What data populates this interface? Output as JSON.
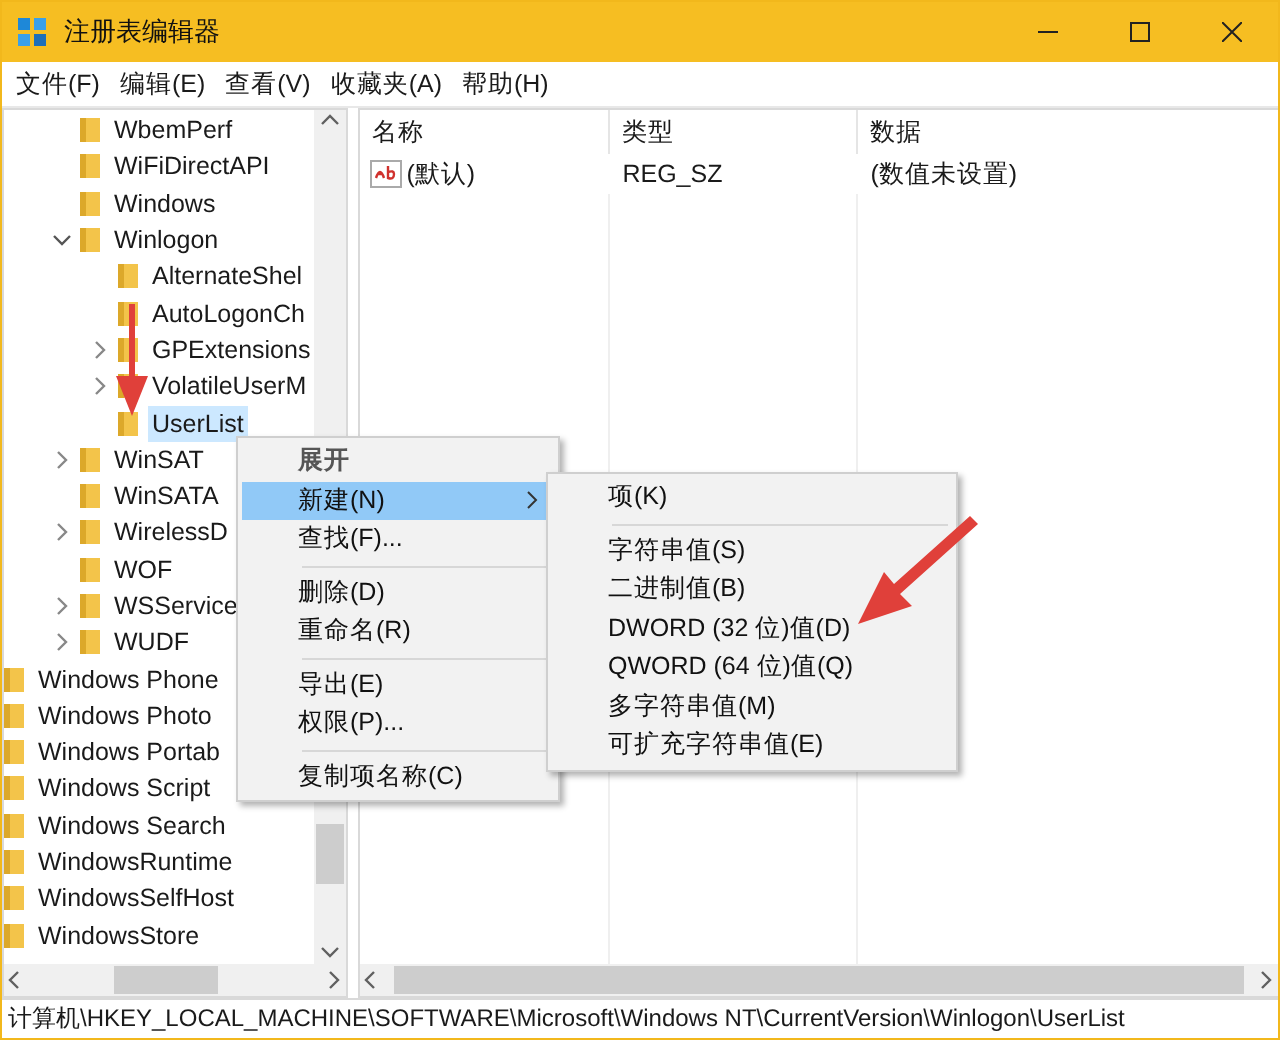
{
  "window": {
    "title": "注册表编辑器"
  },
  "menu_bar": [
    {
      "label": "文件(F)"
    },
    {
      "label": "编辑(E)"
    },
    {
      "label": "查看(V)"
    },
    {
      "label": "收藏夹(A)"
    },
    {
      "label": "帮助(H)"
    }
  ],
  "tree": {
    "nested_items": [
      {
        "label": "WbemPerf",
        "selected": false
      },
      {
        "label": "WiFiDirectAPI",
        "selected": false
      },
      {
        "label": "Windows",
        "selected": false
      },
      {
        "label": "Winlogon",
        "expanded": true,
        "selected": false,
        "children": [
          {
            "label": "AlternateShel",
            "selected": false
          },
          {
            "label": "AutoLogonCh",
            "selected": false
          },
          {
            "label": "GPExtensions",
            "expanded": false,
            "selected": false
          },
          {
            "label": "VolatileUserM",
            "expanded": false,
            "selected": false
          },
          {
            "label": "UserList",
            "selected": true
          }
        ]
      },
      {
        "label": "WinSAT",
        "expanded": false,
        "selected": false
      },
      {
        "label": "WinSATA",
        "selected": false
      },
      {
        "label": "WirelessD",
        "expanded": false,
        "selected": false
      },
      {
        "label": "WOF",
        "selected": false
      },
      {
        "label": "WSService",
        "expanded": false,
        "selected": false
      },
      {
        "label": "WUDF",
        "expanded": false,
        "selected": false
      }
    ],
    "items": [
      {
        "label": "Windows Phone",
        "selected": false
      },
      {
        "label": "Windows Photo",
        "selected": false
      },
      {
        "label": "Windows Portab",
        "selected": false
      },
      {
        "label": "Windows Script",
        "selected": false
      },
      {
        "label": "Windows Search",
        "selected": false
      },
      {
        "label": "WindowsRuntime",
        "selected": false
      },
      {
        "label": "WindowsSelfHost",
        "selected": false
      },
      {
        "label": "WindowsStore",
        "selected": false
      }
    ]
  },
  "values": {
    "columns": [
      "名称",
      "类型",
      "数据"
    ],
    "rows": [
      {
        "name": "(默认)",
        "type": "REG_SZ",
        "data": "(数值未设置)"
      }
    ]
  },
  "context_menu": {
    "groups": [
      [
        {
          "label": "展开",
          "default": true,
          "selected": false,
          "submenu": false
        },
        {
          "label": "新建(N)",
          "default": false,
          "selected": true,
          "submenu": true
        },
        {
          "label": "查找(F)...",
          "default": false,
          "selected": false,
          "submenu": false
        }
      ],
      [
        {
          "label": "删除(D)",
          "default": false,
          "selected": false,
          "submenu": false
        },
        {
          "label": "重命名(R)",
          "default": false,
          "selected": false,
          "submenu": false
        }
      ],
      [
        {
          "label": "导出(E)",
          "default": false,
          "selected": false,
          "submenu": false
        },
        {
          "label": "权限(P)...",
          "default": false,
          "selected": false,
          "submenu": false
        }
      ],
      [
        {
          "label": "复制项名称(C)",
          "default": false,
          "selected": false,
          "submenu": false
        }
      ]
    ]
  },
  "submenu": {
    "groups": [
      [
        {
          "label": "项(K)"
        }
      ],
      [
        {
          "label": "字符串值(S)"
        },
        {
          "label": "二进制值(B)"
        },
        {
          "label": "DWORD (32 位)值(D)"
        },
        {
          "label": "QWORD (64 位)值(Q)"
        },
        {
          "label": "多字符串值(M)"
        },
        {
          "label": "可扩充字符串值(E)"
        }
      ]
    ]
  },
  "status_bar": "计算机\\HKEY_LOCAL_MACHINE\\SOFTWARE\\Microsoft\\Windows NT\\CurrentVersion\\Winlogon\\UserList"
}
